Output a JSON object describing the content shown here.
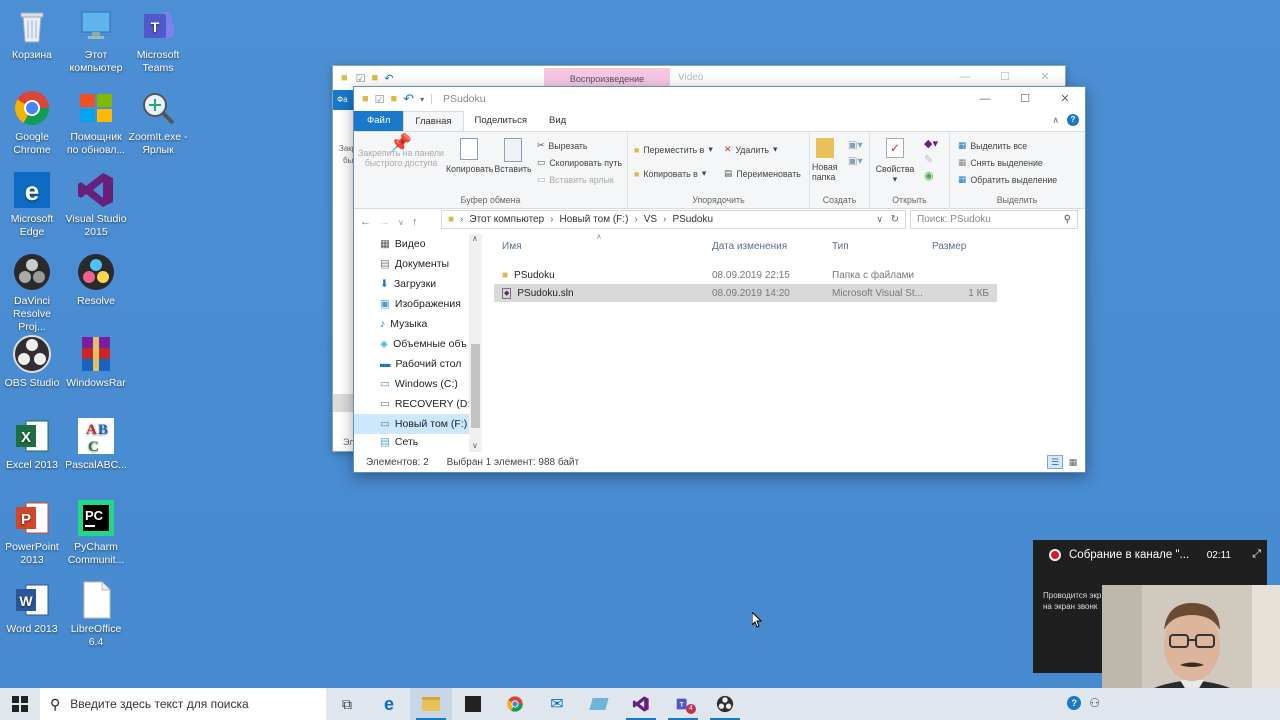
{
  "desktop": {
    "icons": [
      {
        "label": "Корзина",
        "icon": "recycle-bin-icon"
      },
      {
        "label": "Этот компьютер",
        "icon": "this-pc-icon"
      },
      {
        "label": "Microsoft Teams",
        "icon": "teams-icon"
      },
      {
        "label": "Google Chrome",
        "icon": "chrome-icon"
      },
      {
        "label": "Помощник по обновл...",
        "icon": "update-assistant-icon"
      },
      {
        "label": "ZoomIt.exe - Ярлык",
        "icon": "zoomit-icon"
      },
      {
        "label": "Microsoft Edge",
        "icon": "edge-icon"
      },
      {
        "label": "Visual Studio 2015",
        "icon": "visual-studio-icon"
      },
      {
        "label": "DaVinci Resolve Proj...",
        "icon": "davinci-project-icon"
      },
      {
        "label": "Resolve",
        "icon": "resolve-icon"
      },
      {
        "label": "OBS Studio",
        "icon": "obs-icon"
      },
      {
        "label": "WindowsRar",
        "icon": "winrar-icon"
      },
      {
        "label": "Excel 2013",
        "icon": "excel-icon"
      },
      {
        "label": "PascalABC...",
        "icon": "pascalabc-icon"
      },
      {
        "label": "PowerPoint 2013",
        "icon": "powerpoint-icon"
      },
      {
        "label": "PyCharm Communit...",
        "icon": "pycharm-icon"
      },
      {
        "label": "Word 2013",
        "icon": "word-icon"
      },
      {
        "label": "LibreOffice 6.4",
        "icon": "libreoffice-icon"
      }
    ]
  },
  "back_window": {
    "tab_label": "Воспроизведение",
    "title": "Video",
    "side_labels": [
      "Фа",
      "Закр",
      "бы",
      "Эл"
    ]
  },
  "explorer": {
    "title": "PSudoku",
    "tabs": {
      "file": "Файл",
      "home": "Главная",
      "share": "Поделиться",
      "view": "Вид"
    },
    "ribbon": {
      "clipboard": {
        "name": "Буфер обмена",
        "pin": "Закрепить на панели быстрого доступа",
        "copy": "Копировать",
        "paste": "Вставить",
        "cut": "Вырезать",
        "copy_path": "Скопировать путь",
        "paste_shortcut": "Вставить ярлык"
      },
      "organize": {
        "name": "Упорядочить",
        "move_to": "Переместить в",
        "copy_to": "Копировать в",
        "delete": "Удалить",
        "rename": "Переименовать"
      },
      "new": {
        "name": "Создать",
        "new_folder": "Новая папка"
      },
      "open": {
        "name": "Открыть",
        "properties": "Свойства"
      },
      "select": {
        "name": "Выделить",
        "select_all": "Выделить все",
        "select_none": "Снять выделение",
        "invert": "Обратить выделение"
      }
    },
    "address": {
      "parts": [
        "Этот компьютер",
        "Новый том (F:)",
        "VS",
        "PSudoku"
      ],
      "search_placeholder": "Поиск: PSudoku"
    },
    "nav": [
      {
        "label": "Видео",
        "icon": "video-icon"
      },
      {
        "label": "Документы",
        "icon": "documents-icon"
      },
      {
        "label": "Загрузки",
        "icon": "downloads-icon"
      },
      {
        "label": "Изображения",
        "icon": "pictures-icon"
      },
      {
        "label": "Музыка",
        "icon": "music-icon"
      },
      {
        "label": "Объемные объ",
        "icon": "3d-objects-icon"
      },
      {
        "label": "Рабочий стол",
        "icon": "desktop-icon"
      },
      {
        "label": "Windows (C:)",
        "icon": "drive-icon"
      },
      {
        "label": "RECOVERY (D:)",
        "icon": "drive-icon"
      },
      {
        "label": "Новый том (F:)",
        "icon": "drive-icon",
        "selected": true
      },
      {
        "label": "Сеть",
        "icon": "network-icon"
      }
    ],
    "columns": {
      "name": "Имя",
      "modified": "Дата изменения",
      "type": "Тип",
      "size": "Размер"
    },
    "files": [
      {
        "name": "PSudoku",
        "modified": "08.09.2019 22:15",
        "type": "Папка с файлами",
        "size": "",
        "icon": "folder-icon"
      },
      {
        "name": "PSudoku.sln",
        "modified": "08.09.2019 14:20",
        "type": "Microsoft Visual St...",
        "size": "1 КБ",
        "icon": "vs-solution-icon",
        "selected": true
      }
    ],
    "status": {
      "count": "Элементов: 2",
      "selection": "Выбран 1 элемент: 988 байт"
    }
  },
  "taskbar": {
    "search_placeholder": "Введите здесь текст для поиска",
    "teams_badge": "4"
  },
  "teams_popup": {
    "title": "Собрание в канале \"...",
    "time": "02:11",
    "message_line1": "Проводится экр",
    "message_line2": "на экран звонк"
  },
  "colors": {
    "desktop": "#4a8ad0",
    "accent": "#1979ca",
    "selection": "#cce8ff",
    "record": "#e81123"
  }
}
